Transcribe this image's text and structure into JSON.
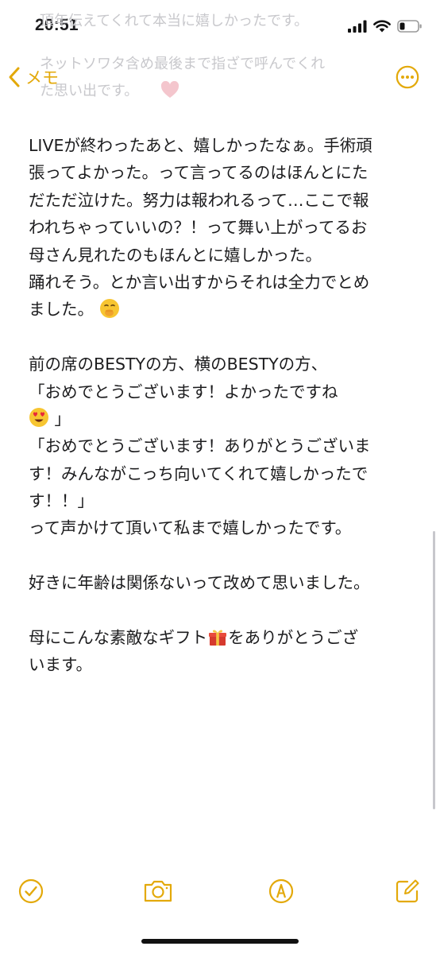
{
  "status_bar": {
    "time": "20:51"
  },
  "faded_text": {
    "line1": "頂年伝えてくれて本当に嬉しかったです。",
    "line2": "ネットソワタ含め最後まで指ざで呼んでくれ",
    "line3": "た思い出です。"
  },
  "nav": {
    "back_label": "メモ"
  },
  "note": {
    "p1_l1": "LIVEが終わったあと、嬉しかったなぁ。手術頑",
    "p1_l2": "張ってよかった。って言ってるのはほんとにた",
    "p1_l3": "だただ泣けた。努力は報われるって…ここで報",
    "p1_l4": "われちゃっていいの？！って舞い上がってるお",
    "p1_l5": "母さん見れたのもほんとに嬉しかった。",
    "p1_l6": "踊れそう。とか言い出すからそれは全力でとめ",
    "p1_l7": "ました。",
    "p2_l1": "前の席のBESTYの方、横のBESTYの方、",
    "p2_l2": "「おめでとうございます！よかったですね",
    "p2_l3": "」",
    "p2_l4": "「おめでとうございます！ありがとうございま",
    "p2_l5": "す！みんながこっち向いてくれて嬉しかったで",
    "p2_l6": "す！！」",
    "p2_l7": "って声かけて頂いて私まで嬉しかったです。",
    "p3_l1": "好きに年齢は関係ないって改めて思いました。",
    "p4_l1a": "母にこんな素敵なギフト",
    "p4_l1b": "をありがとうござ",
    "p4_l2": "います。"
  },
  "emojis": {
    "e1": "face-with-hand-over-mouth",
    "e2": "heart-eyes",
    "e3": "wrapped-gift"
  },
  "toolbar": {
    "icons": [
      "checklist-icon",
      "camera-icon",
      "markup-pen-icon",
      "compose-icon"
    ]
  },
  "colors": {
    "accent": "#e3a90a",
    "text": "#1c1c1e",
    "faded": "#c8c8cc"
  }
}
